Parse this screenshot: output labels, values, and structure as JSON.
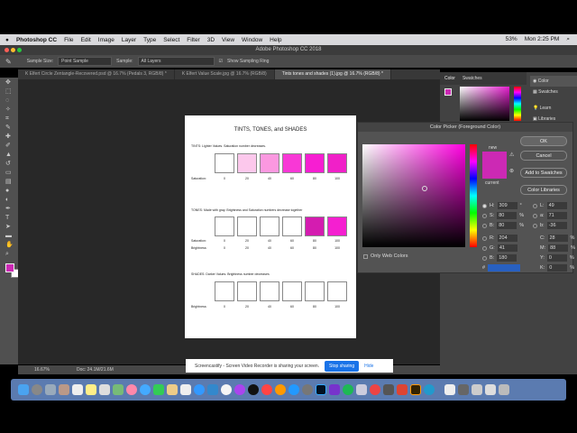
{
  "menubar": {
    "app": "Photoshop CC",
    "items": [
      "File",
      "Edit",
      "Image",
      "Layer",
      "Type",
      "Select",
      "Filter",
      "3D",
      "View",
      "Window",
      "Help"
    ],
    "battery": "53%",
    "clock": "Mon 2:25 PM"
  },
  "window": {
    "title": "Adobe Photoshop CC 2018"
  },
  "options": {
    "sample_size_label": "Sample Size:",
    "sample_size": "Point Sample",
    "sample_label": "Sample:",
    "sample": "All Layers",
    "show_ring": "Show Sampling Ring"
  },
  "tabs": [
    "K Elfert Circle Zentangle-Recovered.psd @ 16.7% (Pedals 3, RGB/8) *",
    "K Elfert Value Scale.jpg @ 16.7% (RGB/8)",
    "Tints tones and shades (1).jpg @ 16.7% (RGB/8) *"
  ],
  "document": {
    "title": "TINTS, TONES, and SHADES",
    "tints": {
      "caption": "TINTS: Lighter Values. Saturation number decreases.",
      "label": "Saturation:",
      "colors": [
        "#ffffff",
        "#fcc8ec",
        "#fb98e0",
        "#f838d6",
        "#f71ed2",
        "#f020c8"
      ]
    },
    "tones": {
      "caption": "TONES: Made with gray. Brightness and Saturation numbers decrease together",
      "label1": "Saturation:",
      "label2": "Brightness:",
      "colors": [
        "#ffffff",
        "#ffffff",
        "#ffffff",
        "#ffffff",
        "#d41cb0",
        "#f51fd0"
      ]
    },
    "shades": {
      "caption": "SHADES: Darker Values. Brightness number decreases",
      "label": "Brightness:",
      "colors": [
        "#ffffff",
        "#ffffff",
        "#ffffff",
        "#ffffff",
        "#ffffff",
        "#ffffff"
      ]
    },
    "values": [
      "0",
      "20",
      "40",
      "60",
      "80",
      "100"
    ]
  },
  "status": {
    "zoom": "16.67%",
    "doc": "Doc: 24.1M/21.6M"
  },
  "panels": {
    "tabs": [
      "Color",
      "Swatches"
    ],
    "side": [
      "Color",
      "Swatches",
      "Learn",
      "Libraries"
    ]
  },
  "dialog": {
    "title": "Color Picker (Foreground Color)",
    "ok": "OK",
    "cancel": "Cancel",
    "add": "Add to Swatches",
    "libraries": "Color Libraries",
    "new": "new",
    "current": "current",
    "web": "Only Web Colors",
    "fields": {
      "H": "309",
      "S": "80",
      "B": "80",
      "R": "204",
      "G": "41",
      "Bl": "180",
      "L": "49",
      "a": "71",
      "b": "-36",
      "C": "28",
      "M": "88",
      "Y": "0",
      "K": "0"
    },
    "hex": "cc29b4",
    "deg": "°",
    "pct": "%"
  },
  "share": {
    "text": "Screencastify - Screen Video Recorder is sharing your screen.",
    "stop": "Stop sharing",
    "hide": "Hide"
  },
  "colors": {
    "accent": "#cc29b4"
  }
}
